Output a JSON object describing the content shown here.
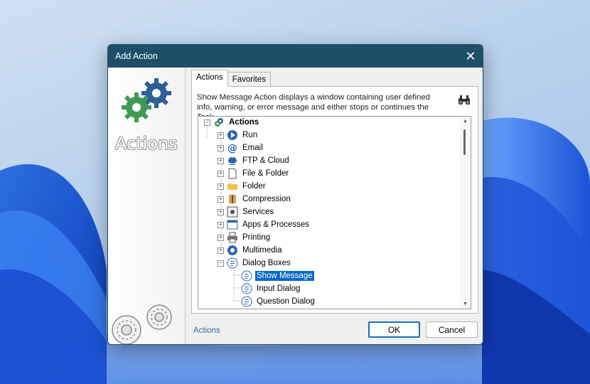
{
  "window": {
    "title": "Add Action"
  },
  "brand": {
    "logo_text": "Actions"
  },
  "tabs": [
    {
      "label": "Actions",
      "active": true
    },
    {
      "label": "Favorites",
      "active": false
    }
  ],
  "description": "Show Message Action displays a window containing user defined info, warning, or error message and either stops or continues the Task.",
  "tree": {
    "root": {
      "label": "Actions",
      "icon": "gear-icon",
      "expanded": true
    },
    "categories": [
      {
        "label": "Run",
        "icon": "run-icon"
      },
      {
        "label": "Email",
        "icon": "email-icon"
      },
      {
        "label": "FTP & Cloud",
        "icon": "cloud-icon"
      },
      {
        "label": "File & Folder",
        "icon": "file-icon"
      },
      {
        "label": "Folder",
        "icon": "folder-icon"
      },
      {
        "label": "Compression",
        "icon": "compression-icon"
      },
      {
        "label": "Services",
        "icon": "services-icon"
      },
      {
        "label": "Apps & Processes",
        "icon": "apps-icon"
      },
      {
        "label": "Printing",
        "icon": "printer-icon"
      },
      {
        "label": "Multimedia",
        "icon": "multimedia-icon"
      },
      {
        "label": "Dialog Boxes",
        "icon": "dialog-icon",
        "expanded": true
      }
    ],
    "children": [
      {
        "label": "Show Message",
        "icon": "message-icon",
        "selected": true
      },
      {
        "label": "Input Dialog",
        "icon": "message-icon"
      },
      {
        "label": "Question Dialog",
        "icon": "message-icon"
      }
    ]
  },
  "footer": {
    "link_label": "Actions",
    "ok_label": "OK",
    "cancel_label": "Cancel"
  },
  "colors": {
    "titlebar": "#1e4f69",
    "selection": "#0a68c6",
    "link": "#3166a8"
  }
}
